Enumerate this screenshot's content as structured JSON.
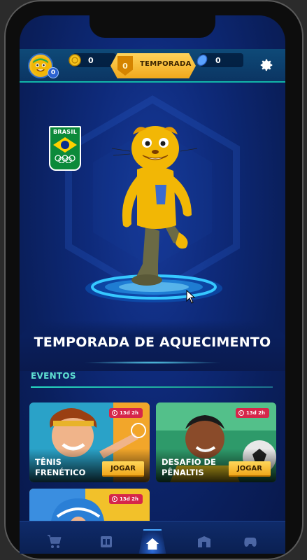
{
  "header": {
    "avatar_level": "0",
    "coins": "0",
    "season_level": "0",
    "season_label": "TEMPORADA",
    "gems": "0"
  },
  "hero": {
    "country_label": "BRASIL"
  },
  "section": {
    "title": "TEMPORADA DE AQUECIMENTO",
    "tab_events": "EVENTOS"
  },
  "events": [
    {
      "name_line1": "TÊNIS",
      "name_line2": "FRENÉTICO",
      "timer": "13d 2h",
      "play": "JOGAR"
    },
    {
      "name_line1": "DESAFIO DE",
      "name_line2": "PÊNALTIS",
      "timer": "13d 2h",
      "play": "JOGAR"
    },
    {
      "timer": "13d 2h"
    }
  ],
  "nav": {
    "items": [
      "shop-icon",
      "locker-icon",
      "home-icon",
      "inventory-icon",
      "gamepad-icon"
    ]
  },
  "colors": {
    "accent_teal": "#27d9c4",
    "gold": "#f0a81c",
    "timer_red": "#d6264a",
    "bg_blue": "#0e2a7a"
  }
}
